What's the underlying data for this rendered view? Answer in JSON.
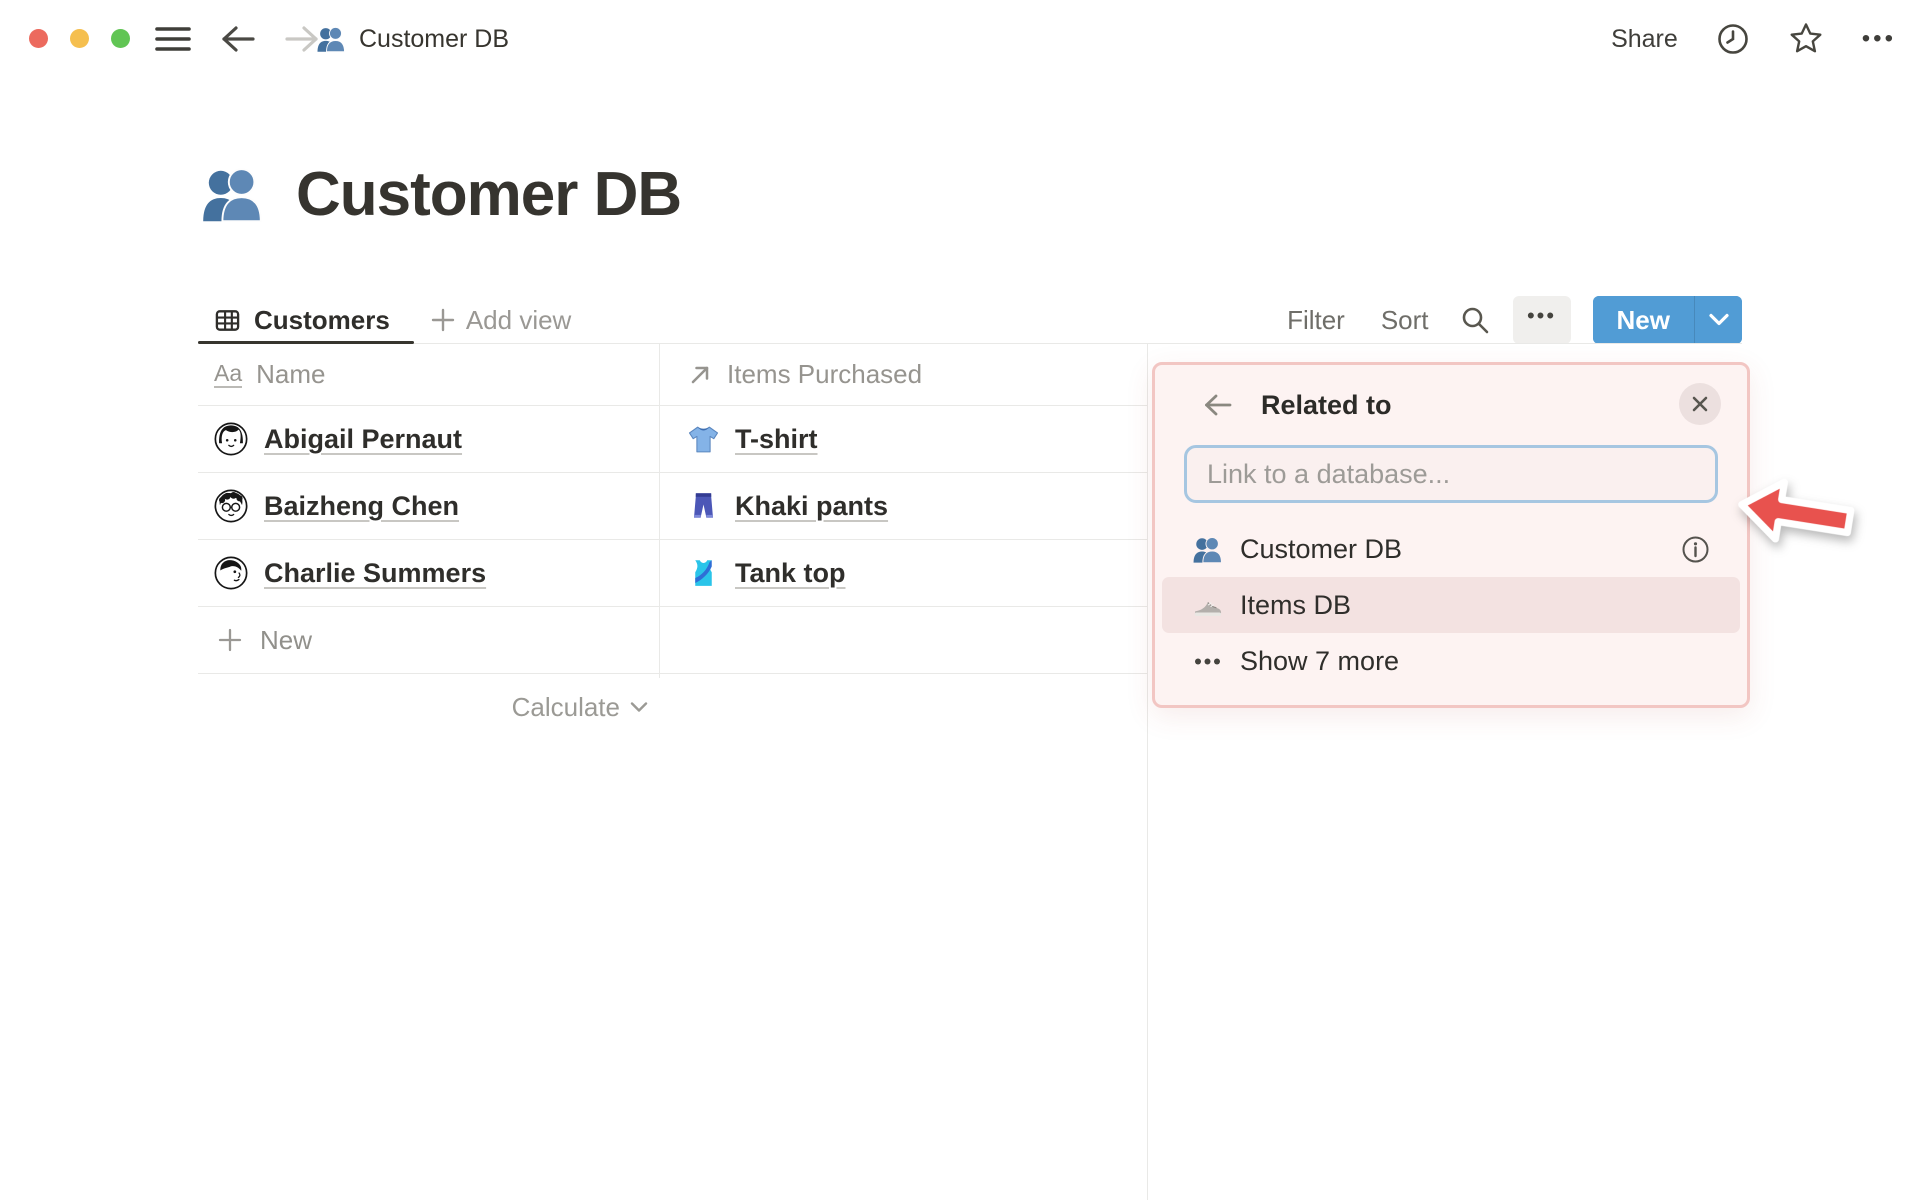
{
  "window": {
    "breadcrumb_title": "Customer DB",
    "share_label": "Share",
    "more_label": "•••"
  },
  "page": {
    "title": "Customer DB",
    "icon": "people-icon"
  },
  "toolbar": {
    "tab_label": "Customers",
    "add_view_label": "Add view",
    "filter_label": "Filter",
    "sort_label": "Sort",
    "more_label": "•••",
    "new_label": "New"
  },
  "table": {
    "header": {
      "name_icon_text": "Aa",
      "name": "Name",
      "items": "Items Purchased"
    },
    "rows": [
      {
        "name": "Abigail Pernaut",
        "avatar": "avatar-abigail",
        "item": "T-shirt",
        "item_icon": "tshirt-icon"
      },
      {
        "name": "Baizheng Chen",
        "avatar": "avatar-baizheng",
        "item": "Khaki pants",
        "item_icon": "jeans-icon"
      },
      {
        "name": "Charlie Summers",
        "avatar": "avatar-charlie",
        "item": "Tank top",
        "item_icon": "tanktop-icon"
      }
    ],
    "new_row_label": "New",
    "calculate_label": "Calculate"
  },
  "popup": {
    "title": "Related to",
    "search_placeholder": "Link to a database...",
    "items": [
      {
        "label": "Customer DB",
        "icon": "people-icon",
        "trailing": "info-icon"
      },
      {
        "label": "Items DB",
        "icon": "sneaker-icon",
        "highlighted": true
      },
      {
        "label": "Show 7 more",
        "icon": "dots-icon"
      }
    ]
  },
  "colors": {
    "accent_blue": "#519cd5",
    "annotation_red": "#e8524e",
    "popup_bg": "#fdf3f2",
    "popup_border": "#f2c6c3",
    "highlight_row": "#f3e2e1",
    "traffic_red": "#ec6a5e",
    "traffic_yellow": "#f5bf4f",
    "traffic_green": "#61c554"
  }
}
